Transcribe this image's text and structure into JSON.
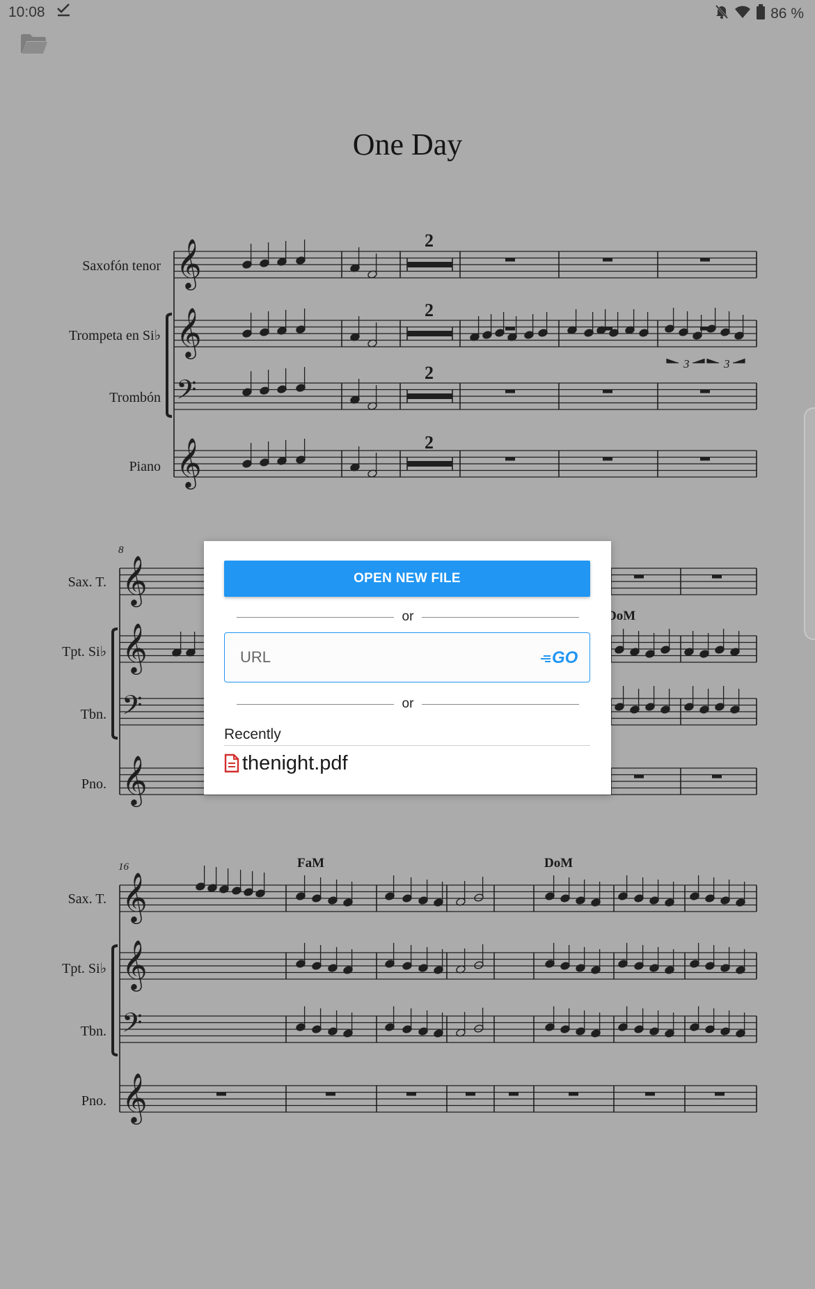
{
  "status_bar": {
    "time": "10:08",
    "battery": "86 %",
    "icons": [
      "check-download-icon",
      "bell-off-icon",
      "wifi-icon",
      "battery-icon"
    ]
  },
  "toolbar": {
    "folder_icon": "folder-open-icon"
  },
  "score": {
    "title": "One Day",
    "system1_labels": [
      "Saxofón tenor",
      "Trompeta en Si♭",
      "Trombón",
      "Piano"
    ],
    "system2_labels": [
      "Sax. T.",
      "Tpt. Si♭",
      "Tbn.",
      "Pno."
    ],
    "system3_labels": [
      "Sax. T.",
      "Tpt. Si♭",
      "Tbn.",
      "Pno."
    ],
    "multirest_count": "2",
    "measure_number_system2": "8",
    "measure_number_system3": "16",
    "chord_system2": "DoM",
    "chords_system3": [
      "FaM",
      "DoM"
    ],
    "triplet": "3"
  },
  "dialog": {
    "open_button": "OPEN NEW FILE",
    "or_1": "or",
    "url_placeholder": "URL",
    "go_label": "GO",
    "or_2": "or",
    "recently_label": "Recently",
    "recent_files": [
      "thenight.pdf"
    ]
  },
  "colors": {
    "overlay_background": "#ababab",
    "accent": "#2196f3",
    "pdf_icon": "#d32f2f"
  }
}
